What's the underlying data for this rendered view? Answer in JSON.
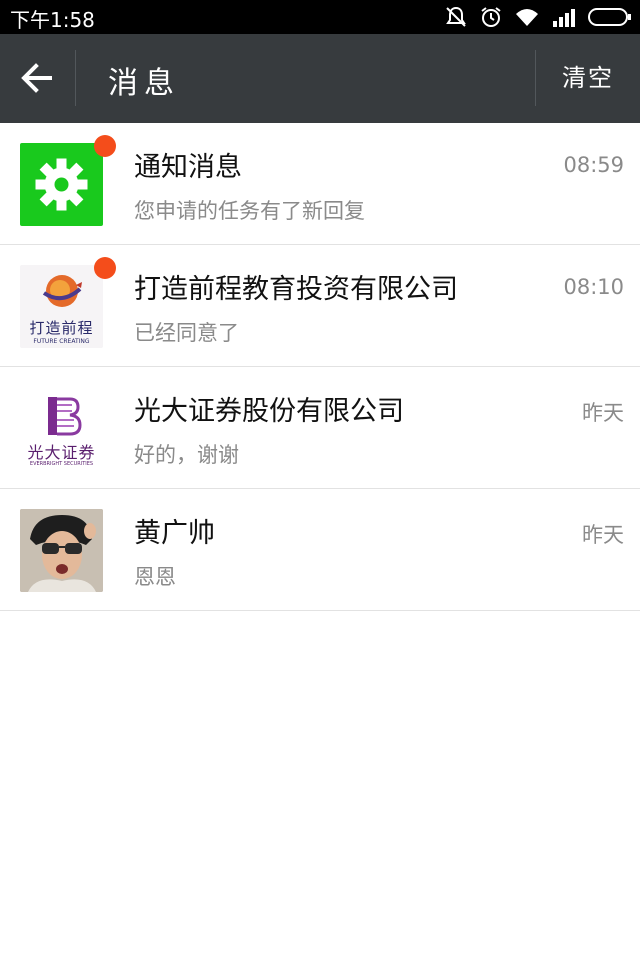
{
  "status_bar": {
    "time": "下午1:58",
    "icons": [
      "mute-icon",
      "alarm-icon",
      "wifi-icon",
      "signal-icon",
      "battery-icon"
    ]
  },
  "header": {
    "title": "消息",
    "clear_label": "清空",
    "back_icon": "back-arrow-icon"
  },
  "colors": {
    "header_bg": "#373b3e",
    "unread_dot": "#f44d1b",
    "notify_green": "#19c91d"
  },
  "messages": [
    {
      "name": "通知消息",
      "preview": "您申请的任务有了新回复",
      "time": "08:59",
      "unread": true,
      "avatar": "gear-icon"
    },
    {
      "name": "打造前程教育投资有限公司",
      "preview": "已经同意了",
      "time": "08:10",
      "unread": true,
      "avatar": "future-creating-logo",
      "avatar_text": "打造前程",
      "avatar_subtext": "FUTURE CREATING"
    },
    {
      "name": "光大证券股份有限公司",
      "preview": "好的，谢谢",
      "time": "昨天",
      "unread": false,
      "avatar": "everbright-logo",
      "avatar_text": "光大证券",
      "avatar_subtext": "EVERBRIGHT SECURITIES"
    },
    {
      "name": "黄广帅",
      "preview": "恩恩",
      "time": "昨天",
      "unread": false,
      "avatar": "user-photo"
    }
  ]
}
